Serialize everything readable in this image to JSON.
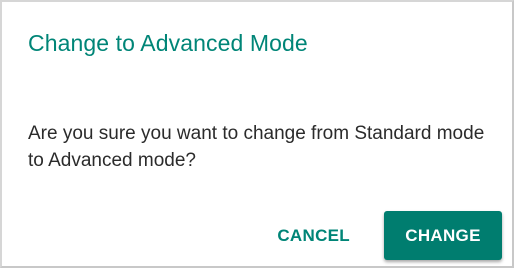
{
  "dialog": {
    "title": "Change to Advanced Mode",
    "message": "Are you sure you want to change from Standard mode to Advanced mode?",
    "cancel_label": "CANCEL",
    "confirm_label": "CHANGE"
  },
  "colors": {
    "accent": "#008577",
    "primary_button": "#007d6f",
    "text": "#2b2b2b",
    "border": "#c8c8c8"
  }
}
